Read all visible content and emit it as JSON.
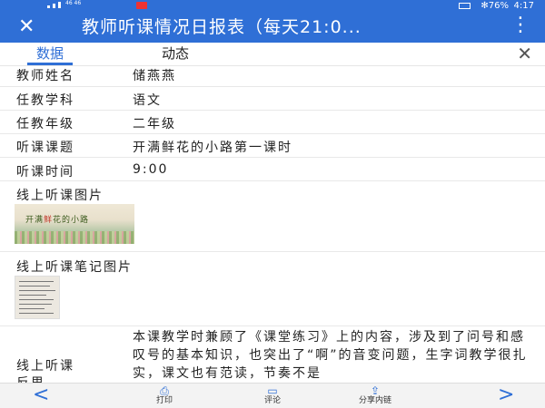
{
  "status_bar": {
    "carrier": "46 46",
    "right_text": "✻76%",
    "time": "4:17"
  },
  "title_bar": {
    "close_icon": "close-icon",
    "title": "教师听课情况日报表（每天21:0...",
    "menu_icon": "more-menu-icon"
  },
  "tabs": [
    {
      "label": "数据",
      "active": true
    },
    {
      "label": "动态",
      "active": false
    }
  ],
  "fields": [
    {
      "label": "教师姓名",
      "value": "储燕燕"
    },
    {
      "label": "任教学科",
      "value": "语文"
    },
    {
      "label": "任教年级",
      "value": "二年级"
    },
    {
      "label": "听课课题",
      "value": "开满鲜花的小路第一课时"
    },
    {
      "label": "听课时间",
      "value": "9:00"
    }
  ],
  "image_fields": [
    {
      "label": "线上听课图片",
      "image_caption_a": "开满",
      "image_caption_b": "鲜",
      "image_caption_c": "花的小路"
    },
    {
      "label": "线上听课笔记图片"
    }
  ],
  "reflection": {
    "label_line1": "线上听课",
    "label_line2": "反思",
    "text": "本课教学时兼顾了《课堂练习》上的内容，涉及到了问号和感叹号的基本知识，也突出了“啊”的音变问题，生字词教学很扎实，课文也有范读，节奏不是"
  },
  "bottom_bar": {
    "prev": "<",
    "next": ">",
    "print": "打印",
    "comment": "评论",
    "share": "分享内链"
  }
}
